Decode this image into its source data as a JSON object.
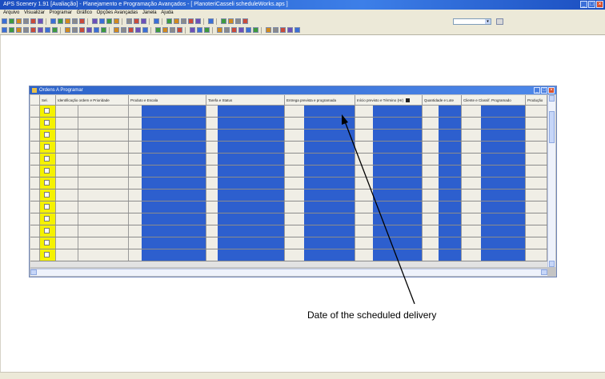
{
  "app": {
    "title": "APS Scenery 1.91 [Avaliação] - Planejamento e Programação Avançados - [ PlanoteriCasseli scheduleWorks.aps ]",
    "window_controls": [
      "_",
      "□",
      "×"
    ]
  },
  "menu": {
    "items": [
      "Arquivo",
      "Visualizar",
      "Programar",
      "Gráfico",
      "Opções Avançadas",
      "Janela",
      "Ajuda"
    ]
  },
  "toolbar": {
    "combo_value": ""
  },
  "child_window": {
    "title": "Ordens A Programar",
    "columns": [
      "Sel.",
      "Identificação ordem e Prioridade",
      "Produto e Escala",
      "Tarefa e Status",
      "Entrega prevista e programada",
      "Início previsto e Término (Hr)",
      "Quantidade e Lote",
      "Cliente e Classif. Programado",
      "Produção"
    ]
  },
  "annotation": {
    "text": "Date of the scheduled delivery"
  }
}
